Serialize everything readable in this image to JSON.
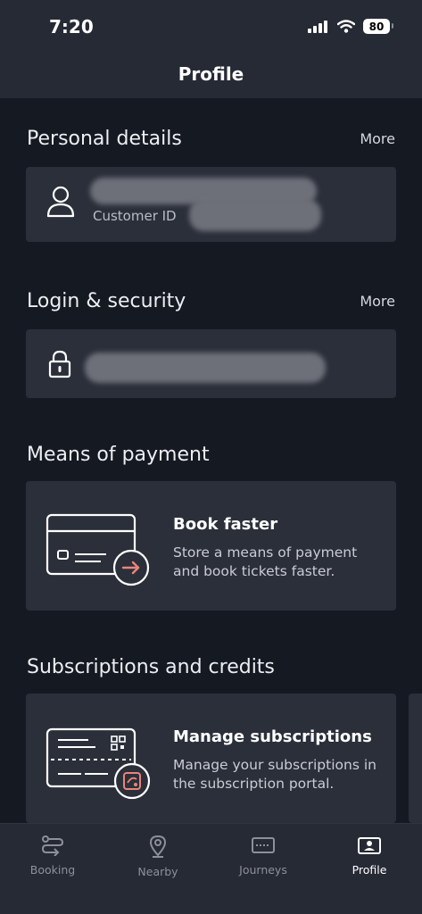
{
  "status": {
    "time": "7:20",
    "battery": "80"
  },
  "header": {
    "title": "Profile"
  },
  "personal": {
    "title": "Personal details",
    "more": "More",
    "customer_id_label": "Customer ID"
  },
  "login": {
    "title": "Login & security",
    "more": "More"
  },
  "payment": {
    "title": "Means of payment",
    "heading": "Book faster",
    "text": "Store a means of payment and book tickets faster."
  },
  "subscriptions": {
    "title": "Subscriptions and credits",
    "heading": "Manage subscriptions",
    "text": "Manage your subscriptions in the subscription portal."
  },
  "tabs": [
    {
      "label": "Booking",
      "icon": "route-icon"
    },
    {
      "label": "Nearby",
      "icon": "location-pin-icon"
    },
    {
      "label": "Journeys",
      "icon": "ticket-icon"
    },
    {
      "label": "Profile",
      "icon": "profile-card-icon",
      "active": true
    }
  ],
  "colors": {
    "accent": "#e8857a",
    "background": "#151922",
    "card": "#2b2f3a"
  }
}
